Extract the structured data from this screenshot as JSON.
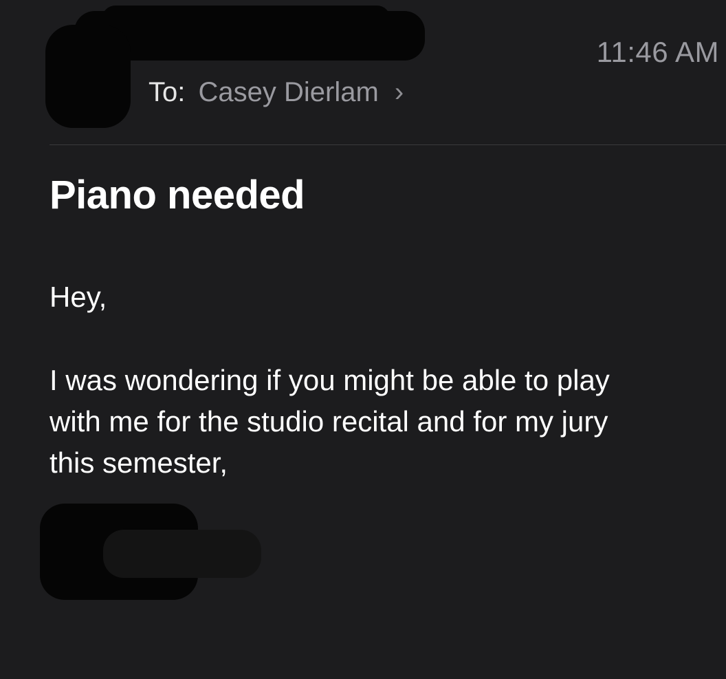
{
  "message": {
    "time": "11:46 AM",
    "to_label": "To:",
    "to_name": "Casey Dierlam",
    "to_chevron": "›",
    "subject": "Piano needed",
    "greeting": "Hey,",
    "body_lines": [
      "I was wondering if you might be able to play",
      "with me for the studio recital and for my jury",
      "this semester,"
    ]
  },
  "icons": {
    "recipient_chevron": "chevron-right-icon",
    "sender_avatar": "avatar"
  },
  "colors": {
    "background": "#1c1c1e",
    "primary_text": "#ffffff",
    "secondary_text": "#9a9aa0",
    "divider": "#3a3a3c"
  }
}
